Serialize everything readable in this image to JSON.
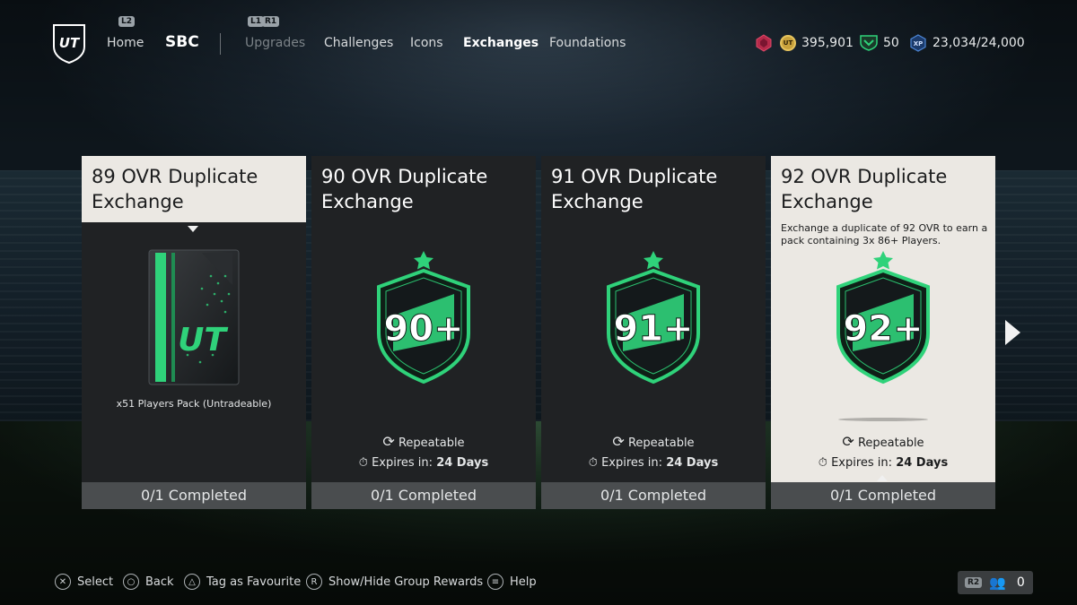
{
  "nav": {
    "hint_l2": "L2",
    "hint_l1": "L1",
    "hint_r1": "R1",
    "home": "Home",
    "sbc": "SBC",
    "tabs": [
      "Upgrades",
      "Challenges",
      "Icons",
      "Exchanges",
      "Foundations"
    ],
    "active_tab": "Exchanges"
  },
  "currency": {
    "coins": "395,901",
    "points": "50",
    "xp": "23,034/24,000",
    "coin_label": "UT",
    "xp_label": "XP"
  },
  "cards": [
    {
      "title_line1": "89 OVR Duplicate",
      "title_line2": "Exchange",
      "reward": "x51 Players Pack (Untradeable)",
      "status": "0/1 Completed"
    },
    {
      "title_line1": "90 OVR Duplicate",
      "title_line2": "Exchange",
      "badge": "90+",
      "repeatable": "Repeatable",
      "expires_label": "Expires in:",
      "expires_value": "24 Days",
      "status": "0/1 Completed"
    },
    {
      "title_line1": "91 OVR Duplicate",
      "title_line2": "Exchange",
      "badge": "91+",
      "repeatable": "Repeatable",
      "expires_label": "Expires in:",
      "expires_value": "24 Days",
      "status": "0/1 Completed"
    },
    {
      "title_line1": "92 OVR Duplicate",
      "title_line2": "Exchange",
      "description": "Exchange a duplicate of 92 OVR to earn a pack containing 3x 86+ Players.",
      "badge": "92+",
      "repeatable": "Repeatable",
      "expires_label": "Expires in:",
      "expires_value": "24 Days",
      "status": "0/1 Completed"
    }
  ],
  "pack_logo": "UT",
  "hints": {
    "select": "Select",
    "back": "Back",
    "favourite": "Tag as Favourite",
    "toggle": "Show/Hide Group Rewards",
    "help": "Help",
    "r_button": "R",
    "r2_label": "R2",
    "group_count": "0"
  },
  "colors": {
    "accent_green": "#2fd27a",
    "card_dark": "#202224",
    "card_light": "#ebe8e3"
  }
}
